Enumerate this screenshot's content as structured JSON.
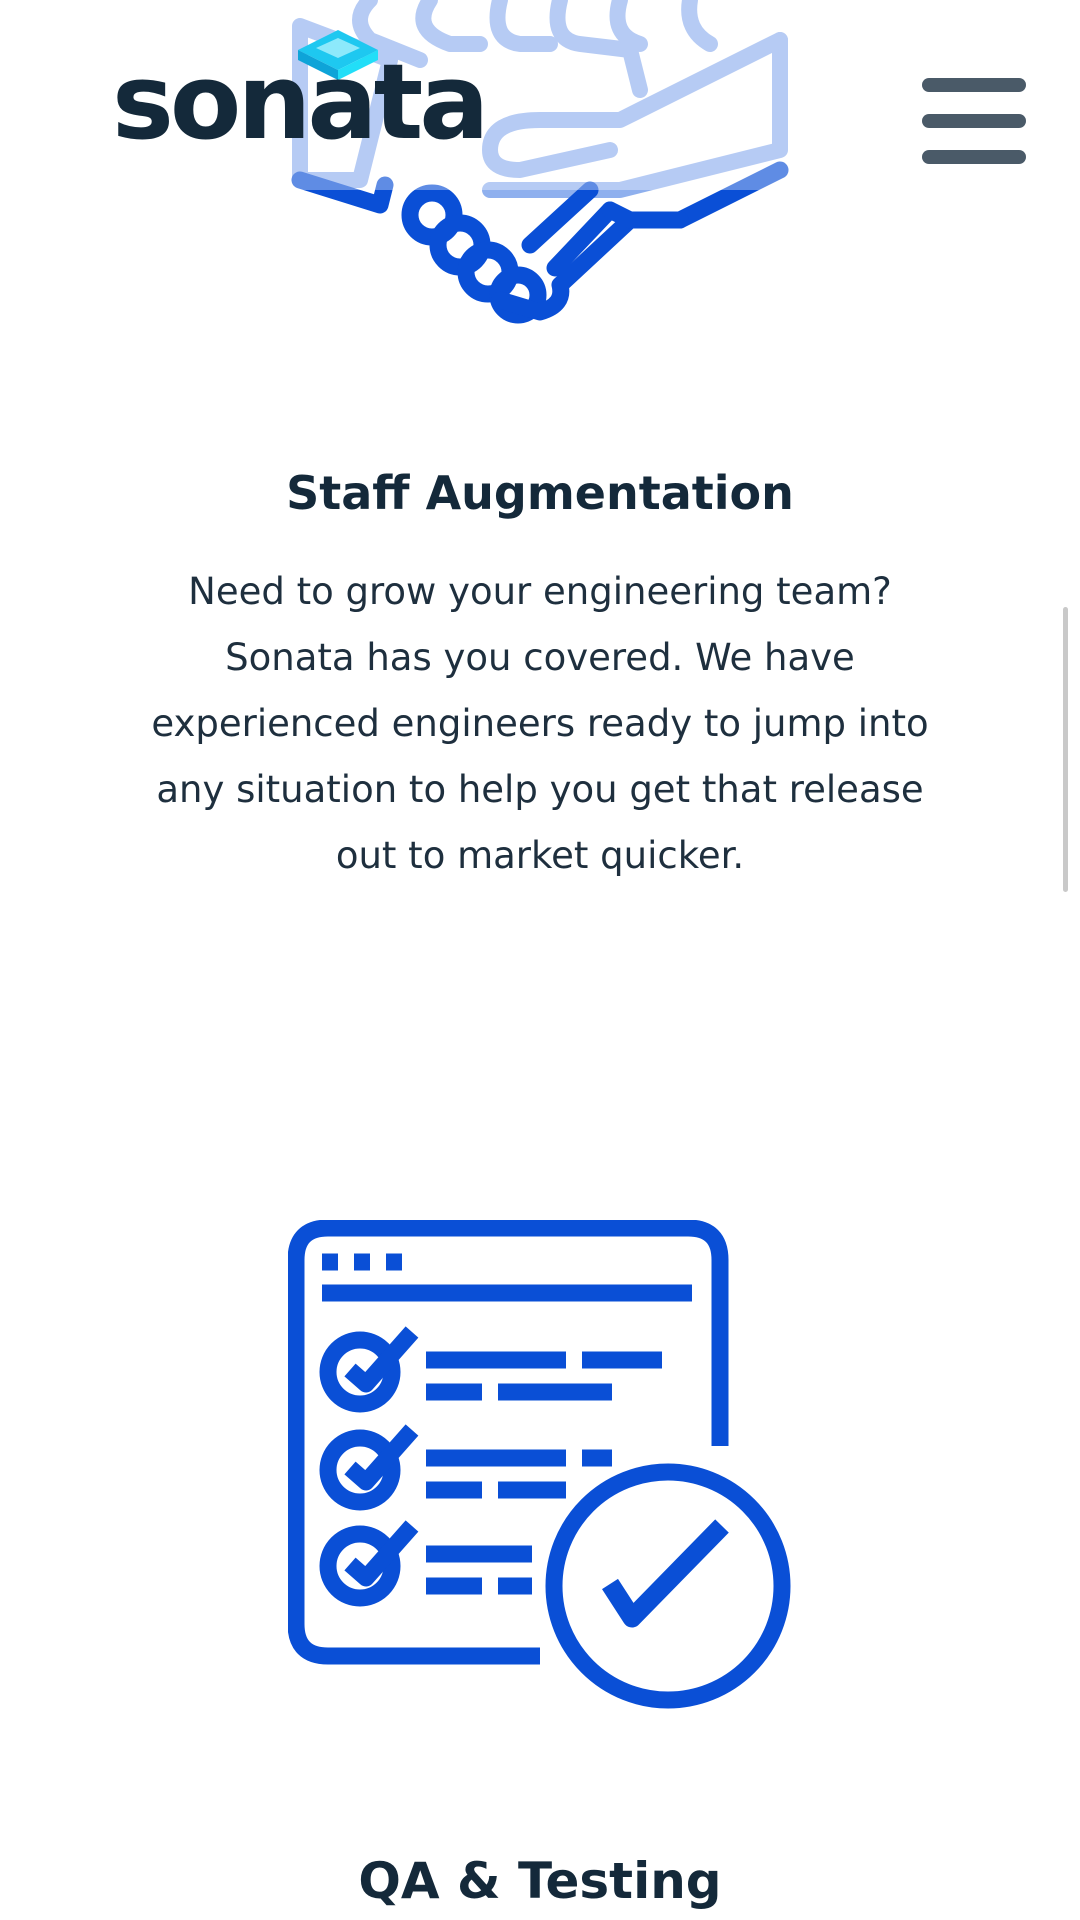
{
  "header": {
    "logo_text": "sonata",
    "menu_icon": "hamburger-menu-icon"
  },
  "services": [
    {
      "icon": "handshake-icon",
      "title": "Staff Augmentation",
      "description": "Need to grow your engineering team? Sonata has you covered. We have experienced engineers ready to jump into any situation to help you get that release out to market quicker."
    },
    {
      "icon": "checklist-approved-icon",
      "title": "QA & Testing"
    }
  ],
  "colors": {
    "brand_dark": "#14293a",
    "brand_cyan": "#1ec8f0",
    "icon_blue": "#0a4fd6",
    "icon_light_blue": "#8fb0ee",
    "menu_gray": "#4a5a68"
  }
}
